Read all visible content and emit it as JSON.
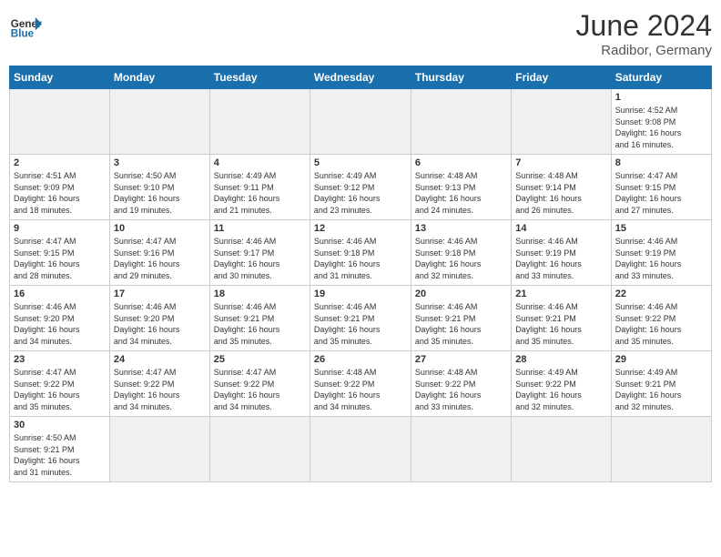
{
  "header": {
    "logo_general": "General",
    "logo_blue": "Blue",
    "month_year": "June 2024",
    "location": "Radibor, Germany"
  },
  "days_of_week": [
    "Sunday",
    "Monday",
    "Tuesday",
    "Wednesday",
    "Thursday",
    "Friday",
    "Saturday"
  ],
  "weeks": [
    [
      {
        "num": "",
        "info": ""
      },
      {
        "num": "",
        "info": ""
      },
      {
        "num": "",
        "info": ""
      },
      {
        "num": "",
        "info": ""
      },
      {
        "num": "",
        "info": ""
      },
      {
        "num": "",
        "info": ""
      },
      {
        "num": "1",
        "info": "Sunrise: 4:52 AM\nSunset: 9:08 PM\nDaylight: 16 hours\nand 16 minutes."
      }
    ],
    [
      {
        "num": "2",
        "info": "Sunrise: 4:51 AM\nSunset: 9:09 PM\nDaylight: 16 hours\nand 18 minutes."
      },
      {
        "num": "3",
        "info": "Sunrise: 4:50 AM\nSunset: 9:10 PM\nDaylight: 16 hours\nand 19 minutes."
      },
      {
        "num": "4",
        "info": "Sunrise: 4:49 AM\nSunset: 9:11 PM\nDaylight: 16 hours\nand 21 minutes."
      },
      {
        "num": "5",
        "info": "Sunrise: 4:49 AM\nSunset: 9:12 PM\nDaylight: 16 hours\nand 23 minutes."
      },
      {
        "num": "6",
        "info": "Sunrise: 4:48 AM\nSunset: 9:13 PM\nDaylight: 16 hours\nand 24 minutes."
      },
      {
        "num": "7",
        "info": "Sunrise: 4:48 AM\nSunset: 9:14 PM\nDaylight: 16 hours\nand 26 minutes."
      },
      {
        "num": "8",
        "info": "Sunrise: 4:47 AM\nSunset: 9:15 PM\nDaylight: 16 hours\nand 27 minutes."
      }
    ],
    [
      {
        "num": "9",
        "info": "Sunrise: 4:47 AM\nSunset: 9:15 PM\nDaylight: 16 hours\nand 28 minutes."
      },
      {
        "num": "10",
        "info": "Sunrise: 4:47 AM\nSunset: 9:16 PM\nDaylight: 16 hours\nand 29 minutes."
      },
      {
        "num": "11",
        "info": "Sunrise: 4:46 AM\nSunset: 9:17 PM\nDaylight: 16 hours\nand 30 minutes."
      },
      {
        "num": "12",
        "info": "Sunrise: 4:46 AM\nSunset: 9:18 PM\nDaylight: 16 hours\nand 31 minutes."
      },
      {
        "num": "13",
        "info": "Sunrise: 4:46 AM\nSunset: 9:18 PM\nDaylight: 16 hours\nand 32 minutes."
      },
      {
        "num": "14",
        "info": "Sunrise: 4:46 AM\nSunset: 9:19 PM\nDaylight: 16 hours\nand 33 minutes."
      },
      {
        "num": "15",
        "info": "Sunrise: 4:46 AM\nSunset: 9:19 PM\nDaylight: 16 hours\nand 33 minutes."
      }
    ],
    [
      {
        "num": "16",
        "info": "Sunrise: 4:46 AM\nSunset: 9:20 PM\nDaylight: 16 hours\nand 34 minutes."
      },
      {
        "num": "17",
        "info": "Sunrise: 4:46 AM\nSunset: 9:20 PM\nDaylight: 16 hours\nand 34 minutes."
      },
      {
        "num": "18",
        "info": "Sunrise: 4:46 AM\nSunset: 9:21 PM\nDaylight: 16 hours\nand 35 minutes."
      },
      {
        "num": "19",
        "info": "Sunrise: 4:46 AM\nSunset: 9:21 PM\nDaylight: 16 hours\nand 35 minutes."
      },
      {
        "num": "20",
        "info": "Sunrise: 4:46 AM\nSunset: 9:21 PM\nDaylight: 16 hours\nand 35 minutes."
      },
      {
        "num": "21",
        "info": "Sunrise: 4:46 AM\nSunset: 9:21 PM\nDaylight: 16 hours\nand 35 minutes."
      },
      {
        "num": "22",
        "info": "Sunrise: 4:46 AM\nSunset: 9:22 PM\nDaylight: 16 hours\nand 35 minutes."
      }
    ],
    [
      {
        "num": "23",
        "info": "Sunrise: 4:47 AM\nSunset: 9:22 PM\nDaylight: 16 hours\nand 35 minutes."
      },
      {
        "num": "24",
        "info": "Sunrise: 4:47 AM\nSunset: 9:22 PM\nDaylight: 16 hours\nand 34 minutes."
      },
      {
        "num": "25",
        "info": "Sunrise: 4:47 AM\nSunset: 9:22 PM\nDaylight: 16 hours\nand 34 minutes."
      },
      {
        "num": "26",
        "info": "Sunrise: 4:48 AM\nSunset: 9:22 PM\nDaylight: 16 hours\nand 34 minutes."
      },
      {
        "num": "27",
        "info": "Sunrise: 4:48 AM\nSunset: 9:22 PM\nDaylight: 16 hours\nand 33 minutes."
      },
      {
        "num": "28",
        "info": "Sunrise: 4:49 AM\nSunset: 9:22 PM\nDaylight: 16 hours\nand 32 minutes."
      },
      {
        "num": "29",
        "info": "Sunrise: 4:49 AM\nSunset: 9:21 PM\nDaylight: 16 hours\nand 32 minutes."
      }
    ],
    [
      {
        "num": "30",
        "info": "Sunrise: 4:50 AM\nSunset: 9:21 PM\nDaylight: 16 hours\nand 31 minutes."
      },
      {
        "num": "",
        "info": ""
      },
      {
        "num": "",
        "info": ""
      },
      {
        "num": "",
        "info": ""
      },
      {
        "num": "",
        "info": ""
      },
      {
        "num": "",
        "info": ""
      },
      {
        "num": "",
        "info": ""
      }
    ]
  ]
}
